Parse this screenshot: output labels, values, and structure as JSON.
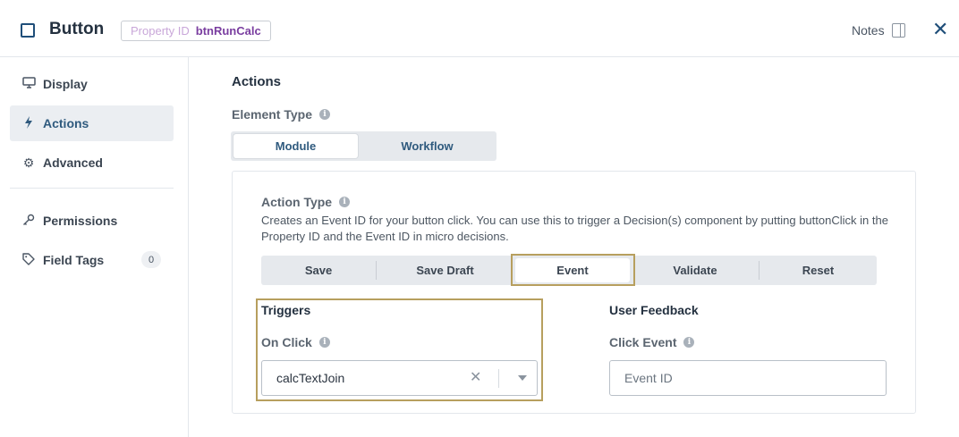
{
  "header": {
    "title": "Button",
    "property_id_label": "Property ID",
    "property_id_value": "btnRunCalc",
    "notes_label": "Notes",
    "close_symbol": "✕"
  },
  "sidebar": {
    "items": [
      {
        "label": "Display",
        "icon": "monitor-icon"
      },
      {
        "label": "Actions",
        "icon": "lightning-icon"
      },
      {
        "label": "Advanced",
        "icon": "gear-icon"
      },
      {
        "label": "Permissions",
        "icon": "key-icon"
      },
      {
        "label": "Field Tags",
        "icon": "tag-icon",
        "badge": "0"
      }
    ],
    "active": "Actions"
  },
  "main": {
    "section_title": "Actions",
    "element_type": {
      "label": "Element Type",
      "options": [
        "Module",
        "Workflow"
      ],
      "selected": "Module"
    },
    "action_type": {
      "label": "Action Type",
      "description": "Creates an Event ID for your button click. You can use this to trigger a Decision(s) component by putting buttonClick in the Property ID and the Event ID in micro decisions.",
      "options": [
        "Save",
        "Save Draft",
        "Event",
        "Validate",
        "Reset"
      ],
      "selected": "Event"
    },
    "triggers": {
      "title": "Triggers",
      "on_click_label": "On Click",
      "on_click_value": "calcTextJoin"
    },
    "user_feedback": {
      "title": "User Feedback",
      "click_event_label": "Click Event",
      "click_event_placeholder": "Event ID"
    }
  },
  "colors": {
    "accent": "#1f4e79",
    "highlight": "#b79f5e",
    "property_value": "#7a3ea0"
  }
}
